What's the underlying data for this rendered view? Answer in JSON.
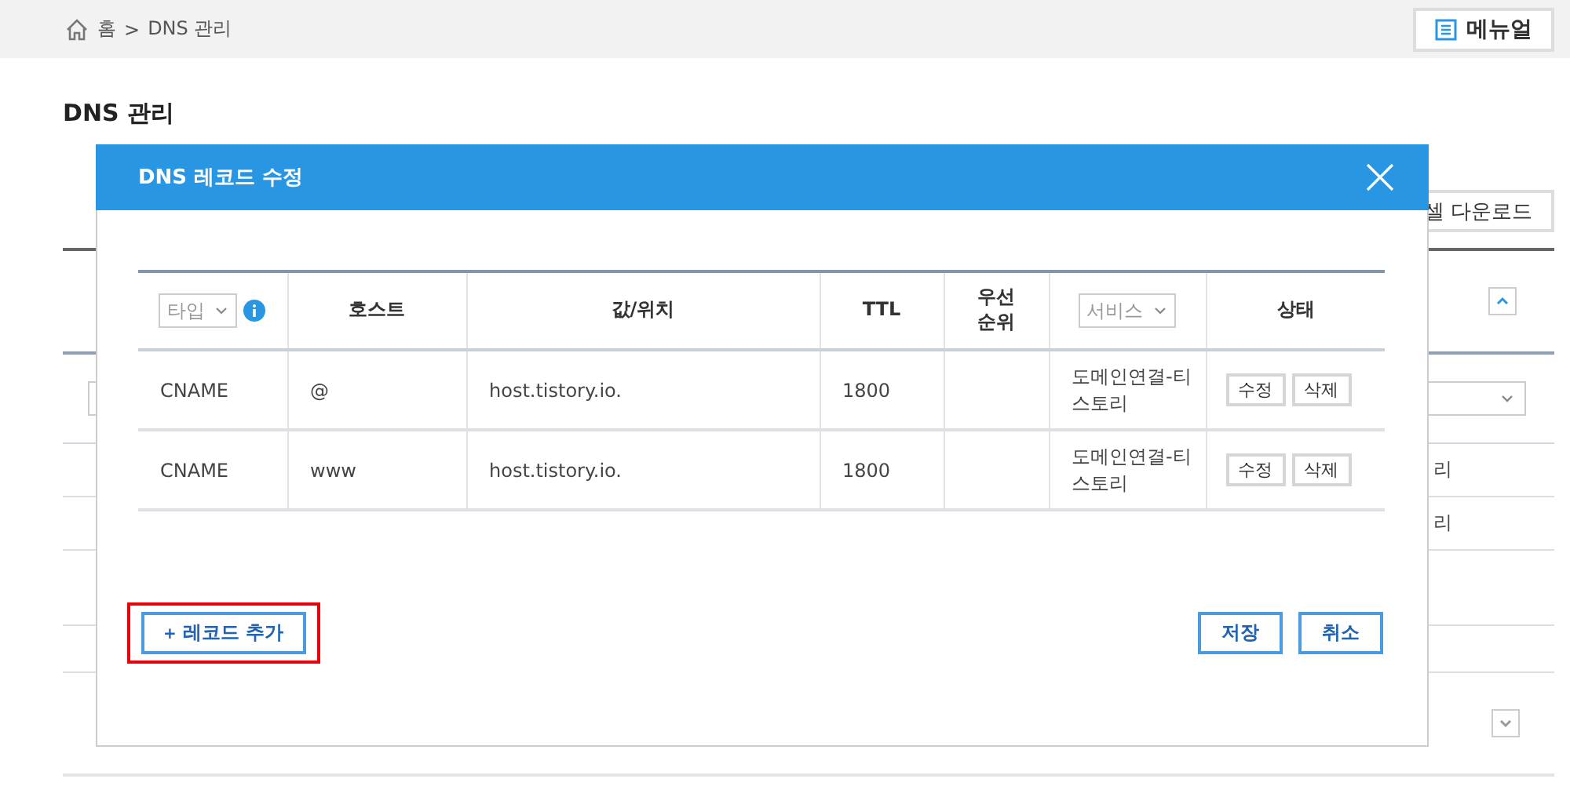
{
  "breadcrumb": {
    "items": [
      "홈",
      "DNS 관리"
    ],
    "separator": ">"
  },
  "manual_button": "메뉴얼",
  "page_title": "DNS 관리",
  "excel_button": "셀 다운로드",
  "background_rows": [
    "리",
    "리"
  ],
  "dialog": {
    "title": "DNS 레코드 수정",
    "columns": [
      {
        "kind": "select",
        "label": "타입",
        "info": true
      },
      {
        "kind": "text",
        "label": "호스트"
      },
      {
        "kind": "text",
        "label": "값/위치"
      },
      {
        "kind": "text",
        "label": "TTL"
      },
      {
        "kind": "text",
        "label": "우선\n순위"
      },
      {
        "kind": "select",
        "label": "서비스",
        "info": false
      },
      {
        "kind": "text",
        "label": "상태"
      }
    ],
    "rows": [
      {
        "type": "CNAME",
        "host": "@",
        "value": "host.tistory.io.",
        "ttl": "1800",
        "service": "도메인연결-티스토리",
        "actions": [
          "수정",
          "삭제"
        ]
      },
      {
        "type": "CNAME",
        "host": "www",
        "value": "host.tistory.io.",
        "ttl": "1800",
        "service": "도메인연결-티스토리",
        "actions": [
          "수정",
          "삭제"
        ]
      }
    ],
    "add_button": {
      "icon": "+",
      "label": "레코드 추가",
      "highlighted": true
    },
    "buttons": [
      "저장",
      "취소"
    ]
  }
}
